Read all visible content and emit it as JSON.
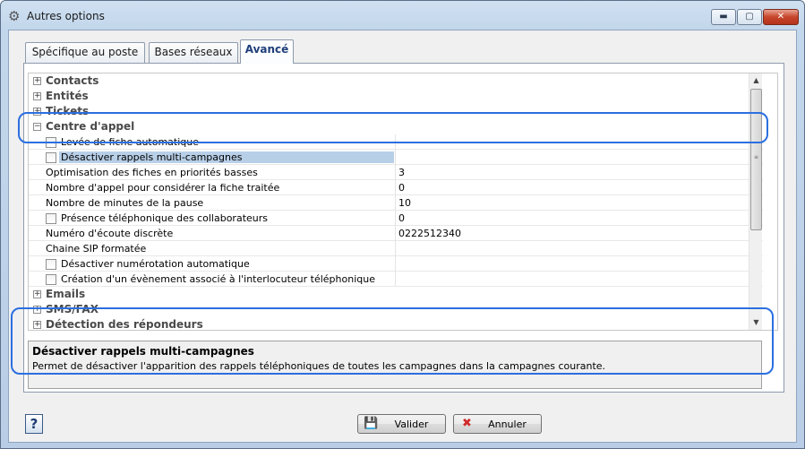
{
  "window": {
    "title": "Autres options",
    "title_icon": "gear-icon",
    "minimize": "▬",
    "maximize": "▢",
    "close": "✕"
  },
  "tabs": [
    {
      "label": "Spécifique au poste"
    },
    {
      "label": "Bases réseaux"
    },
    {
      "label": "Avancé",
      "active": true
    }
  ],
  "grid": {
    "categories": {
      "contacts": "Contacts",
      "entites": "Entités",
      "tickets": "Tickets",
      "centre": "Centre d'appel",
      "emails": "Emails",
      "sms": "SMS/FAX",
      "detection": "Détection des répondeurs"
    },
    "expander_plus": "+",
    "expander_minus": "−",
    "props": [
      {
        "label": "Levée de fiche automatique",
        "value": "",
        "checkbox": true
      },
      {
        "label": "Désactiver rappels multi-campagnes",
        "value": "",
        "checkbox": true,
        "selected": true
      },
      {
        "label": "Optimisation des fiches en priorités basses",
        "value": "3",
        "checkbox": false
      },
      {
        "label": "Nombre d'appel pour considérer la fiche traitée",
        "value": "0",
        "checkbox": false
      },
      {
        "label": "Nombre de minutes de la pause",
        "value": "10",
        "checkbox": false
      },
      {
        "label": "Présence téléphonique des collaborateurs",
        "value": "0",
        "checkbox": true
      },
      {
        "label": "Numéro d'écoute discrète",
        "value": "0222512340",
        "checkbox": false
      },
      {
        "label": "Chaine SIP formatée",
        "value": "",
        "checkbox": false
      },
      {
        "label": "Désactiver numérotation automatique",
        "value": "",
        "checkbox": true
      },
      {
        "label": "Création d'un évènement associé à l'interlocuteur téléphonique",
        "value": "",
        "checkbox": true
      }
    ]
  },
  "description": {
    "title": "Désactiver rappels multi-campagnes",
    "text": "Permet de désactiver l'apparition des rappels téléphoniques de toutes les campagnes dans la campagnes courante."
  },
  "buttons": {
    "help": "?",
    "ok": "Valider",
    "ok_icon": "save-icon",
    "cancel": "Annuler",
    "cancel_icon": "cancel-icon"
  },
  "colors": {
    "highlight": "#2b6fe0",
    "selection": "#b8cfe8",
    "active_tab_text": "#1f3f7a"
  }
}
